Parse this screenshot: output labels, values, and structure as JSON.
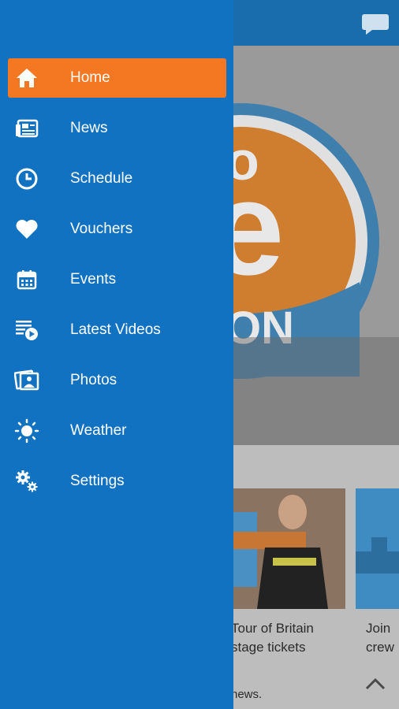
{
  "drawer": {
    "items": [
      {
        "label": "Home",
        "icon": "home-icon",
        "active": true
      },
      {
        "label": "News",
        "icon": "news-icon",
        "active": false
      },
      {
        "label": "Schedule",
        "icon": "clock-icon",
        "active": false
      },
      {
        "label": "Vouchers",
        "icon": "heart-icon",
        "active": false
      },
      {
        "label": "Events",
        "icon": "calendar-icon",
        "active": false
      },
      {
        "label": "Latest Videos",
        "icon": "video-list-icon",
        "active": false
      },
      {
        "label": "Photos",
        "icon": "photos-icon",
        "active": false
      },
      {
        "label": "Weather",
        "icon": "sun-icon",
        "active": false
      },
      {
        "label": "Settings",
        "icon": "gears-icon",
        "active": false
      }
    ]
  },
  "background": {
    "cards": [
      {
        "line1": "Tour of Britain",
        "line2": "stage tickets"
      },
      {
        "line1": "Join",
        "line2": "crew"
      }
    ],
    "footer_text": "news."
  },
  "colors": {
    "drawer": "#1172c1",
    "active_item": "#f47722",
    "topbar": "#1a6dad"
  }
}
